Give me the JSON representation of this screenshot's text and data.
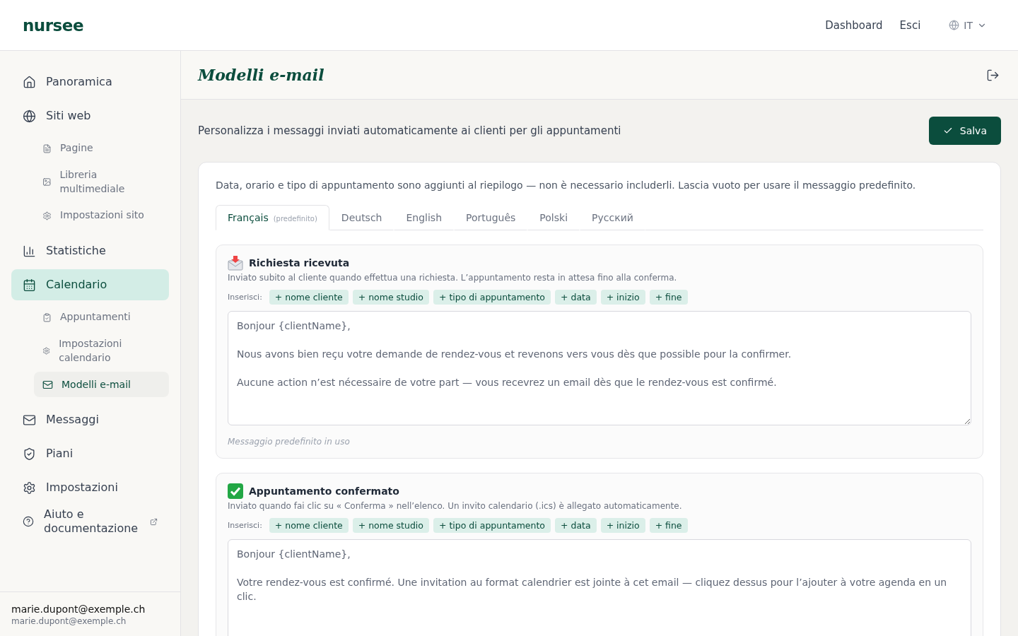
{
  "header": {
    "logo": "nursee",
    "nav": [
      "Dashboard",
      "Esci"
    ],
    "language": "IT"
  },
  "sidebar": {
    "items": [
      {
        "label": "Panoramica",
        "kind": "page",
        "selected": false
      },
      {
        "label": "Siti web",
        "kind": "page",
        "selected": false,
        "children": [
          {
            "label": "Pagine",
            "selected": false
          },
          {
            "label": "Libreria multimediale",
            "selected": false
          },
          {
            "label": "Impostazioni sito",
            "selected": false
          }
        ]
      },
      {
        "label": "Statistiche",
        "kind": "page",
        "selected": false
      },
      {
        "label": "Calendario",
        "kind": "page",
        "selected": true,
        "children": [
          {
            "label": "Appuntamenti",
            "selected": false
          },
          {
            "label": "Impostazioni calendario",
            "selected": false
          },
          {
            "label": "Modelli e-mail",
            "selected": true
          }
        ]
      },
      {
        "label": "Messaggi",
        "kind": "page",
        "selected": false
      },
      {
        "label": "Piani",
        "kind": "page",
        "selected": false
      },
      {
        "label": "Impostazioni",
        "kind": "page",
        "selected": false
      },
      {
        "label": "Aiuto e documentazione",
        "kind": "external",
        "selected": false
      }
    ],
    "user": {
      "name": "marie.dupont@exemple.ch",
      "email": "marie.dupont@exemple.ch"
    }
  },
  "page": {
    "title": "Modelli e-mail",
    "subtitle": "Personalizza i messaggi inviati automaticamente ai clienti per gli appuntamenti",
    "save_button": "Salva"
  },
  "info": "Data, orario e tipo di appuntamento sono aggiunti al riepilogo — non è necessario includerli. Lascia vuoto per usare il messaggio predefinito.",
  "tabs": [
    {
      "label": "Français",
      "note": "(predefinito)",
      "selected": true
    },
    {
      "label": "Deutsch",
      "selected": false
    },
    {
      "label": "English",
      "selected": false
    },
    {
      "label": "Português",
      "selected": false
    },
    {
      "label": "Polski",
      "selected": false
    },
    {
      "label": "Русский",
      "selected": false
    }
  ],
  "templates": [
    {
      "kind": "request",
      "title": "Richiesta ricevuta",
      "description": "Inviato subito al cliente quando effettua una richiesta. L’appuntamento resta in attesa fino alla conferma.",
      "insert_label": "Inserisci:",
      "chips": [
        "+ nome cliente",
        "+ nome studio",
        "+ tipo di appuntamento",
        "+ data",
        "+ inizio",
        "+ fine"
      ],
      "placeholder": "Bonjour {clientName},\n\nNous avons bien reçu votre demande de rendez-vous et revenons vers vous dès que possible pour la confirmer.\n\nAucune action n’est nécessaire de votre part — vous recevrez un email dès que le rendez-vous est confirmé.",
      "status": "Messaggio predefinito in uso"
    },
    {
      "kind": "confirmed",
      "title": "Appuntamento confermato",
      "description": "Inviato quando fai clic su « Conferma » nell’elenco. Un invito calendario (.ics) è allegato automaticamente.",
      "insert_label": "Inserisci:",
      "chips": [
        "+ nome cliente",
        "+ nome studio",
        "+ tipo di appuntamento",
        "+ data",
        "+ inizio",
        "+ fine"
      ],
      "placeholder": "Bonjour {clientName},\n\nVotre rendez-vous est confirmé. Une invitation au format calendrier est jointe à cet email — cliquez dessus pour l’ajouter à votre agenda en un clic."
    }
  ]
}
